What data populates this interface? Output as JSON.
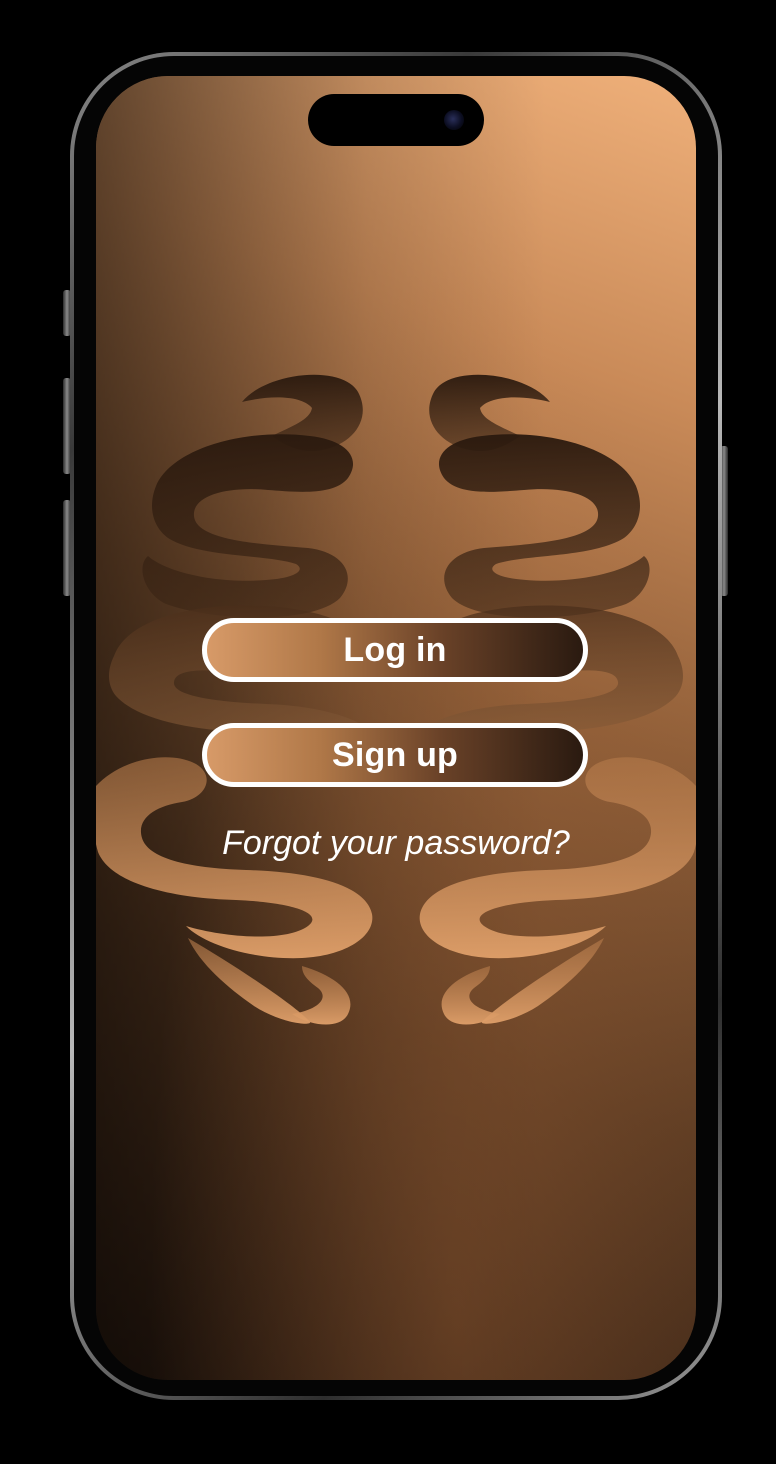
{
  "auth": {
    "login_label": "Log in",
    "signup_label": "Sign up",
    "forgot_label": "Forgot your password?"
  },
  "icons": {
    "emblem": "symmetric-swirl-emblem-icon",
    "camera": "front-camera-icon"
  },
  "colors": {
    "background_light": "#efb07a",
    "background_dark": "#2a1a10",
    "button_border": "#ffffff",
    "text": "#ffffff"
  }
}
